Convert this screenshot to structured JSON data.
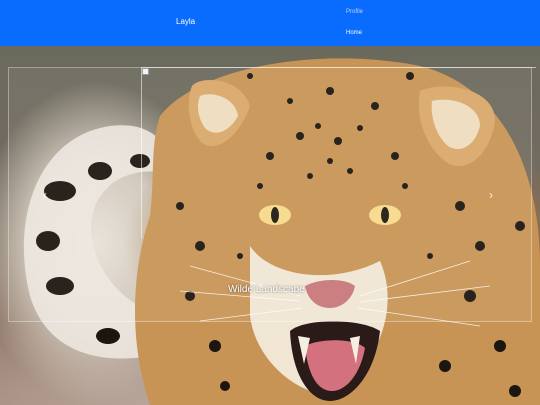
{
  "navbar": {
    "brand": "Layla",
    "links": {
      "profile": "Profile",
      "home": "Home"
    },
    "color": "#0a6cff"
  },
  "carousel": {
    "caption": "Wilde Landscape",
    "prev_icon": "chevron-left-icon",
    "next_icon": "chevron-right-icon",
    "image_subject": "leopard-photo"
  }
}
